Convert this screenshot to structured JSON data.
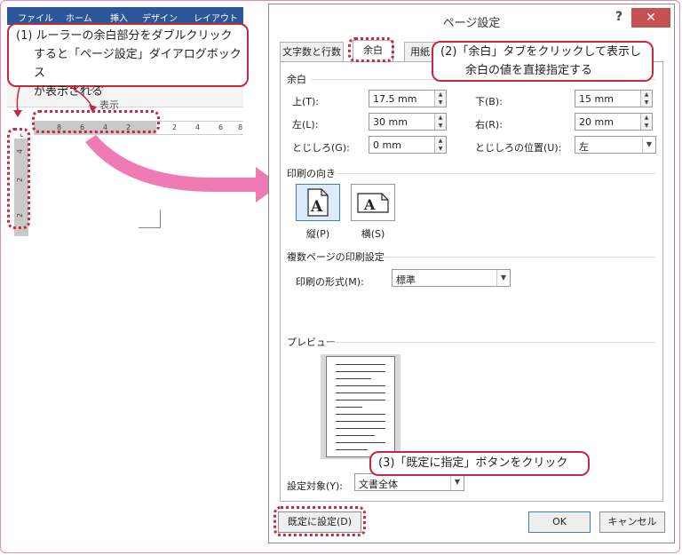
{
  "word": {
    "tabs": [
      "ファイル",
      "ホーム",
      "挿入",
      "デザイン",
      "レイアウト"
    ],
    "group_label": "レイアウト",
    "ribbon_section": "表示",
    "hruler_ticks": [
      "8",
      "6",
      "4",
      "2",
      "2",
      "4",
      "6",
      "8"
    ],
    "vruler_ticks": [
      "4",
      "2",
      "2"
    ]
  },
  "callouts": {
    "step1": [
      "(1) ルーラーの余白部分をダブルクリック",
      "すると「ページ設定」ダイアログボックス",
      "が表示される"
    ],
    "step2": [
      "(2)「余白」タブをクリックして表示し",
      "余白の値を直接指定する"
    ],
    "step3": "(3)「既定に指定」ボタンをクリック"
  },
  "dialog": {
    "title": "ページ設定",
    "help": "?",
    "close": "✕",
    "tabs": [
      "文字数と行数",
      "余白",
      "用紙"
    ],
    "margins": {
      "heading": "余白",
      "top_label": "上(T):",
      "top_value": "17.5 mm",
      "bottom_label": "下(B):",
      "bottom_value": "15 mm",
      "left_label": "左(L):",
      "left_value": "30 mm",
      "right_label": "右(R):",
      "right_value": "20 mm",
      "gutter_label": "とじしろ(G):",
      "gutter_value": "0 mm",
      "gutter_pos_label": "とじしろの位置(U):",
      "gutter_pos_value": "左"
    },
    "orientation": {
      "heading": "印刷の向き",
      "portrait": "縦(P)",
      "landscape": "横(S)"
    },
    "pages": {
      "heading": "複数ページの印刷設定",
      "format_label": "印刷の形式(M):",
      "format_value": "標準"
    },
    "preview": {
      "heading": "プレビュー"
    },
    "apply": {
      "label": "設定対象(Y):",
      "value": "文書全体"
    },
    "buttons": {
      "default": "既定に設定(D)",
      "ok": "OK",
      "cancel": "キャンセル"
    }
  }
}
